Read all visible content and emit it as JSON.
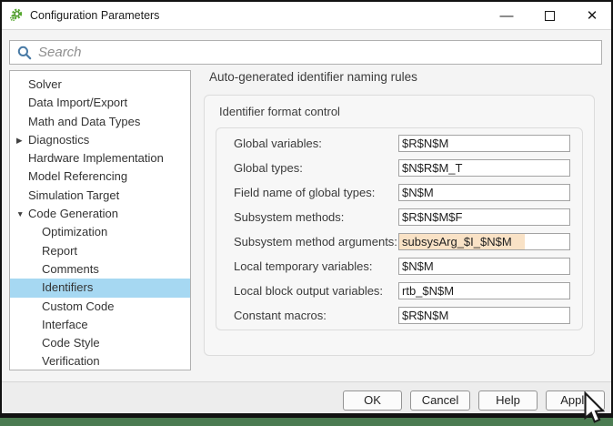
{
  "window": {
    "title": "Configuration Parameters",
    "controls": {
      "minimize_glyph": "—",
      "close_glyph": "✕"
    }
  },
  "search": {
    "placeholder": "Search"
  },
  "sidebar": {
    "items": [
      {
        "label": "Solver",
        "level": 1
      },
      {
        "label": "Data Import/Export",
        "level": 1
      },
      {
        "label": "Math and Data Types",
        "level": 1
      },
      {
        "label": "Diagnostics",
        "level": 1,
        "arrow": "▶",
        "state": "collapsed"
      },
      {
        "label": "Hardware Implementation",
        "level": 1
      },
      {
        "label": "Model Referencing",
        "level": 1
      },
      {
        "label": "Simulation Target",
        "level": 1
      },
      {
        "label": "Code Generation",
        "level": 1,
        "arrow": "▼",
        "state": "expanded"
      },
      {
        "label": "Optimization",
        "level": 2
      },
      {
        "label": "Report",
        "level": 2
      },
      {
        "label": "Comments",
        "level": 2
      },
      {
        "label": "Identifiers",
        "level": 2,
        "selected": true
      },
      {
        "label": "Custom Code",
        "level": 2
      },
      {
        "label": "Interface",
        "level": 2
      },
      {
        "label": "Code Style",
        "level": 2
      },
      {
        "label": "Verification",
        "level": 2
      }
    ]
  },
  "main": {
    "heading": "Auto-generated identifier naming rules",
    "group_title": "Identifier format control",
    "fields": [
      {
        "label": "Global variables:",
        "value": "$R$N$M"
      },
      {
        "label": "Global types:",
        "value": "$N$R$M_T"
      },
      {
        "label": "Field name of global types:",
        "value": "$N$M"
      },
      {
        "label": "Subsystem methods:",
        "value": "$R$N$M$F"
      },
      {
        "label": "Subsystem method arguments:",
        "value": "subsysArg_$I_$N$M",
        "highlighted": true
      },
      {
        "label": "Local temporary variables:",
        "value": "$N$M"
      },
      {
        "label": "Local block output variables:",
        "value": "rtb_$N$M"
      },
      {
        "label": "Constant macros:",
        "value": "$R$N$M"
      }
    ]
  },
  "footer": {
    "buttons": [
      "OK",
      "Cancel",
      "Help",
      "Apply"
    ]
  },
  "colors": {
    "selected_item_bg": "#a6d8f2",
    "highlight_field_bg": "#f9e2c6",
    "green_bar": "#4b7b51",
    "search_icon": "#4a7ba6",
    "app_icon_green": "#56a82f"
  }
}
